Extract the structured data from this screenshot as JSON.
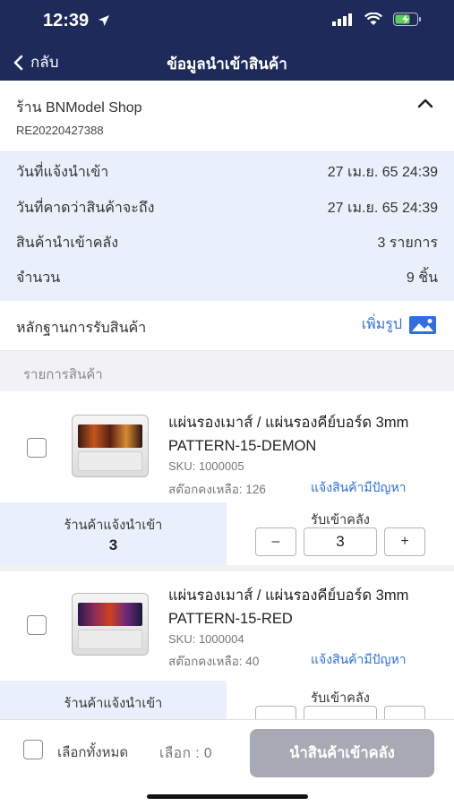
{
  "status": {
    "time": "12:39"
  },
  "nav": {
    "back_label": "กลับ",
    "title": "ข้อมูลนำเข้าสินค้า"
  },
  "shop": {
    "name": "ร้าน  BNModel Shop",
    "code": "RE20220427388"
  },
  "info": [
    {
      "label": "วันที่แจ้งนำเข้า",
      "value": "27 เม.ย. 65 24:39"
    },
    {
      "label": "วันที่คาดว่าสินค้าจะถึง",
      "value": "27 เม.ย. 65 24:39"
    },
    {
      "label": "สินค้านำเข้าคลัง",
      "value": "3 รายการ"
    },
    {
      "label": "จำนวน",
      "value": "9 ชิ้น"
    }
  ],
  "evidence": {
    "label": "หลักฐานการรับสินค้า",
    "add_photo_label": "เพิ่มรูป"
  },
  "list_header": "รายการสินค้า",
  "products": [
    {
      "name": "แผ่นรองเมาส์  / แผ่นรองคีย์บอร์ด 3mm PATTERN-15-DEMON",
      "sku": "SKU: 1000005",
      "stock": "สต๊อกคงเหลือ: 126",
      "report_label": "แจ้งสินค้ามีปัญหา",
      "notified_label": "ร้านค้าแจ้งนำเข้า",
      "notified_qty": "3",
      "receive_label": "รับเข้าคลัง",
      "receive_qty": "3",
      "minus": "–",
      "plus": "+"
    },
    {
      "name": "แผ่นรองเมาส์  / แผ่นรองคีย์บอร์ด 3mm PATTERN-15-RED",
      "sku": "SKU: 1000004",
      "stock": "สต๊อกคงเหลือ: 40",
      "report_label": "แจ้งสินค้ามีปัญหา",
      "notified_label": "ร้านค้าแจ้งนำเข้า",
      "notified_qty": "",
      "receive_label": "รับเข้าคลัง",
      "receive_qty": "",
      "minus": "",
      "plus": ""
    }
  ],
  "bottom": {
    "select_all": "เลือกทั้งหมด",
    "selected": "เลือก :  0",
    "submit": "นำสินค้าเข้าคลัง"
  },
  "colors": {
    "header": "#1e2a5a",
    "accent": "#2f6fe0",
    "info_bg": "#eaf0fb",
    "disabled_button": "#a7a9b4"
  }
}
